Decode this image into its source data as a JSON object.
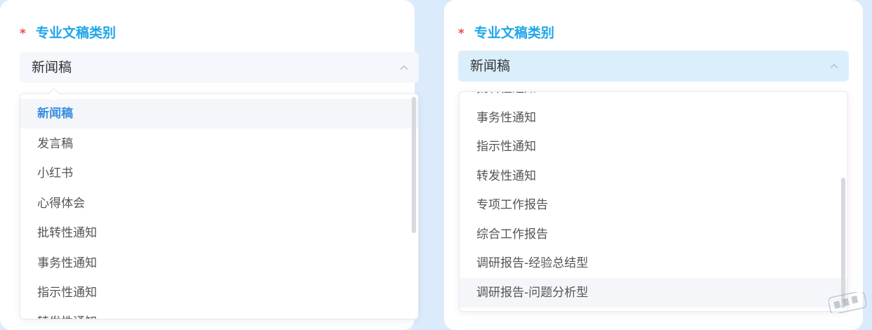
{
  "left_panel": {
    "label_required_mark": "*",
    "label": "专业文稿类别",
    "selected_value": "新闻稿",
    "options": [
      "新闻稿",
      "发言稿",
      "小红书",
      "心得体会",
      "批转性通知",
      "事务性通知",
      "指示性通知",
      "转发性通知"
    ]
  },
  "right_panel": {
    "label_required_mark": "*",
    "label": "专业文稿类别",
    "selected_value": "新闻稿",
    "options": [
      "批转性通知",
      "事务性通知",
      "指示性通知",
      "转发性通知",
      "专项工作报告",
      "综合工作报告",
      "调研报告-经验总结型",
      "调研报告-问题分析型"
    ]
  },
  "colors": {
    "label": "#1fa6e8",
    "required": "#ef4b4b",
    "selected_option": "#3b8fe0",
    "option_text": "#555555"
  }
}
